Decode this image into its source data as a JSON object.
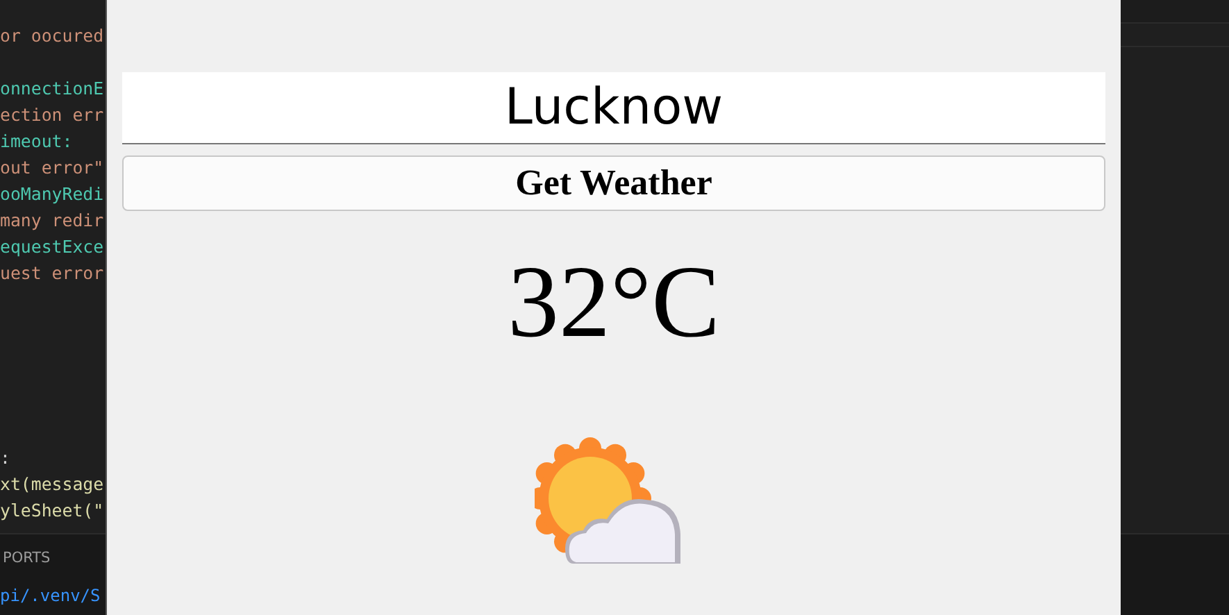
{
  "editor": {
    "code_lines": [
      {
        "text": "or oocured",
        "kind": "string"
      },
      {
        "kind": "blank"
      },
      {
        "text": "onnectionE",
        "kind": "class"
      },
      {
        "text": "ection err",
        "kind": "string"
      },
      {
        "text": "imeout:",
        "kind": "class"
      },
      {
        "text": "out error\"",
        "kind": "string"
      },
      {
        "text": "ooManyRedi",
        "kind": "class"
      },
      {
        "text": "many redir",
        "kind": "string"
      },
      {
        "text": "equestExce",
        "kind": "class"
      },
      {
        "text": "uest error",
        "kind": "string"
      },
      {
        "kind": "blank"
      },
      {
        "kind": "blank"
      },
      {
        "kind": "blank"
      },
      {
        "kind": "blank"
      },
      {
        "kind": "blank"
      },
      {
        "kind": "blank"
      },
      {
        "text": ":",
        "kind": "plain"
      },
      {
        "text": "xt(message",
        "kind": "call"
      },
      {
        "text": "yleSheet(\"",
        "kind": "call"
      }
    ],
    "panel_tab": "PORTS",
    "terminal_line": "pi/.venv/S"
  },
  "app": {
    "city_input": {
      "value": "Lucknow"
    },
    "button": "Get Weather",
    "temperature": "32°C"
  }
}
